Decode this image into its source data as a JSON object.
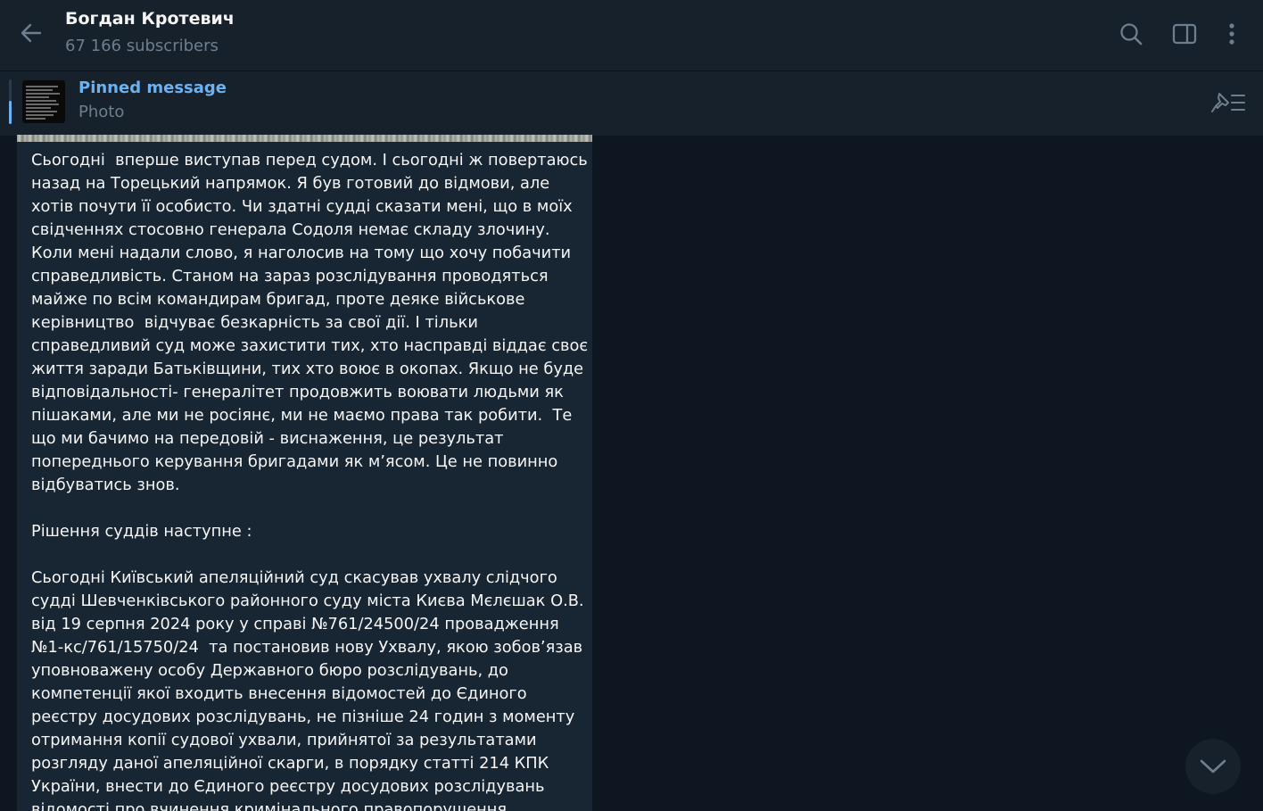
{
  "header": {
    "title": "Богдан Кротевич",
    "subscribers": "67 166 subscribers"
  },
  "pinned": {
    "label": "Pinned message",
    "type": "Photo"
  },
  "message": {
    "lines": [
      "Сьогодні  вперше виступав перед судом. І сьогодні ж повертаюсь",
      "назад на Торецький напрямок. Я був готовий до відмови, але",
      "хотів почути її особисто. Чи здатні судді сказати мені, що в моїх",
      "свідченнях стосовно генерала Содоля немає складу злочину.",
      "Коли мені надали слово, я наголосив на тому що хочу побачити",
      "справедливість. Станом на зараз розслідування проводяться",
      "майже по всім командирам бригад, проте деяке військове",
      "керівництво  відчуває безкарність за свої дії. І тільки",
      "справедливий суд може захистити тих, хто насправді віддає своє",
      "життя заради Батьківщини, тих хто воює в окопах. Якщо не буде",
      "відповідальності- генералітет продовжить воювати людьми як",
      "пішаками, але ми не росіянє, ми не маємо права так робити.  Те",
      "що ми бачимо на передовій - виснаження, це результат",
      "попереднього керування бригадами як м’ясом. Це не повинно",
      "відбуватись знов.",
      "",
      "Рішення суддів наступне :",
      "",
      "Сьогодні Київський апеляційний суд скасував ухвалу слідчого",
      "судді Шевченківського районного суду міста Києва Мєлєшак О.В.",
      "від 19 серпня 2024 року у справі №761/24500/24 провадження",
      "№1-кс/761/15750/24  та постановив нову Ухвалу, якою зобов’язав",
      "уповноважену особу Державного бюро розслідувань, до",
      "компетенції якої входить внесення відомостей до Єдиного",
      "реєстру досудових розслідувань, не пізніше 24 годин з моменту",
      "отримання копії судової ухвали, прийнятої за результатами",
      "розгляду даної апеляційної скарги, в порядку статті 214 КПК",
      "України, внести до Єдиного реєстру досудових розслідувань",
      "відомості про вчинення кримінального правопорушення"
    ]
  },
  "colors": {
    "background": "#0e1621",
    "header": "#17212b",
    "bubble": "#182533",
    "accent": "#6ab2f2",
    "muted": "#6d7f8f"
  },
  "icons": {
    "back": "arrow-left-icon",
    "search": "search-icon",
    "panel": "sidebar-toggle-icon",
    "more": "more-vertical-icon",
    "pin_list": "pin-list-icon",
    "scroll": "chevron-down-icon"
  }
}
